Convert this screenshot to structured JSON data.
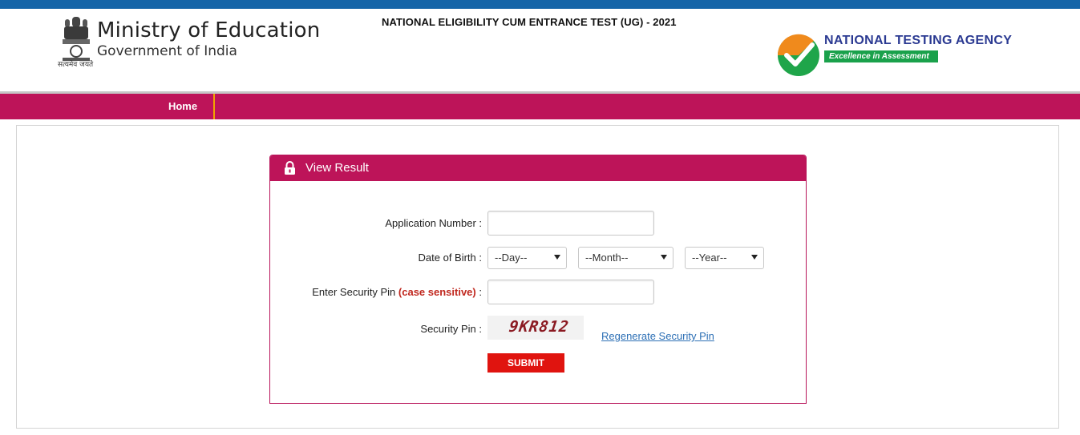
{
  "colors": {
    "top_bar": "#1565a8",
    "brand_magenta": "#bd1459",
    "nav_separator": "#f0a500",
    "submit": "#e0140f",
    "link": "#2c6fb5"
  },
  "header": {
    "ministry_title": "Ministry of Education",
    "ministry_subtitle": "Government of India",
    "emblem_caption": "सत्यमेव जयते",
    "exam_title": "NATIONAL ELIGIBILITY CUM ENTRANCE TEST (UG) - 2021",
    "agency_name": "NATIONAL TESTING AGENCY",
    "agency_tagline": "Excellence in Assessment"
  },
  "nav": {
    "items": [
      {
        "label": "Home"
      }
    ]
  },
  "form": {
    "title": "View Result",
    "title_icon": "lock-icon",
    "application_label": "Application Number :",
    "application_value": "",
    "dob_label": "Date of Birth :",
    "dob_day": "--Day--",
    "dob_month": "--Month--",
    "dob_year": "--Year--",
    "pin_label": "Enter Security Pin",
    "pin_label_note": "(case sensitive)",
    "pin_label_colon": ":",
    "pin_value": "",
    "captcha_label": "Security Pin :",
    "captcha_text": "9KR812",
    "regenerate_link": "Regenerate Security Pin",
    "submit_label": "SUBMIT"
  }
}
